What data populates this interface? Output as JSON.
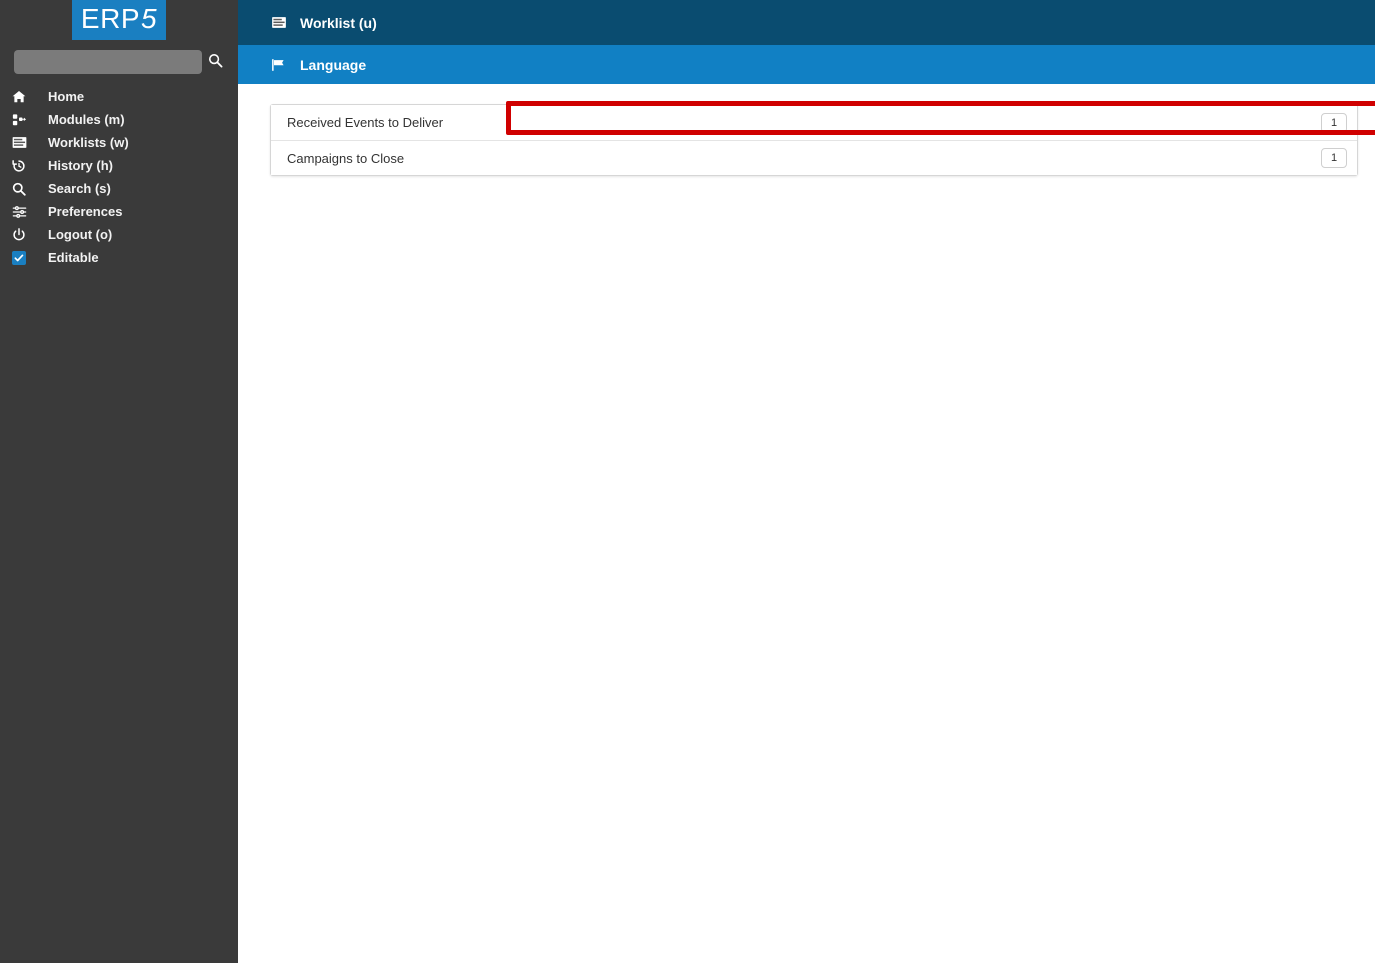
{
  "sidebar": {
    "logo": {
      "text_main": "ERP",
      "text_accent": "5",
      "bg_color": "#1a7fc1"
    },
    "search": {
      "value": "",
      "placeholder": "",
      "icon": "search-icon"
    },
    "items": [
      {
        "label": "Home",
        "icon": "home-icon"
      },
      {
        "label": "Modules (m)",
        "icon": "modules-icon"
      },
      {
        "label": "Worklists (w)",
        "icon": "worklist-lines-icon"
      },
      {
        "label": "History (h)",
        "icon": "history-clock-icon"
      },
      {
        "label": "Search (s)",
        "icon": "search-icon"
      },
      {
        "label": "Preferences",
        "icon": "sliders-icon"
      },
      {
        "label": "Logout (o)",
        "icon": "power-icon"
      },
      {
        "label": "Editable",
        "icon": "checkbox-checked-icon",
        "checked": true
      }
    ],
    "bg_color": "#3a3a3a"
  },
  "header": {
    "top_bar": {
      "title": "Worklist (u)",
      "icon": "worklist-lines-icon",
      "bg_color": "#0a4c70"
    },
    "sub_bar": {
      "title": "Language",
      "icon": "flag-icon",
      "bg_color": "#1180c4"
    }
  },
  "worklist": {
    "rows": [
      {
        "label": "Received Events to Deliver",
        "count": "1",
        "highlighted": true
      },
      {
        "label": "Campaigns to Close",
        "count": "1",
        "highlighted": false
      }
    ]
  },
  "annotation": {
    "highlight_color": "#d00000"
  }
}
